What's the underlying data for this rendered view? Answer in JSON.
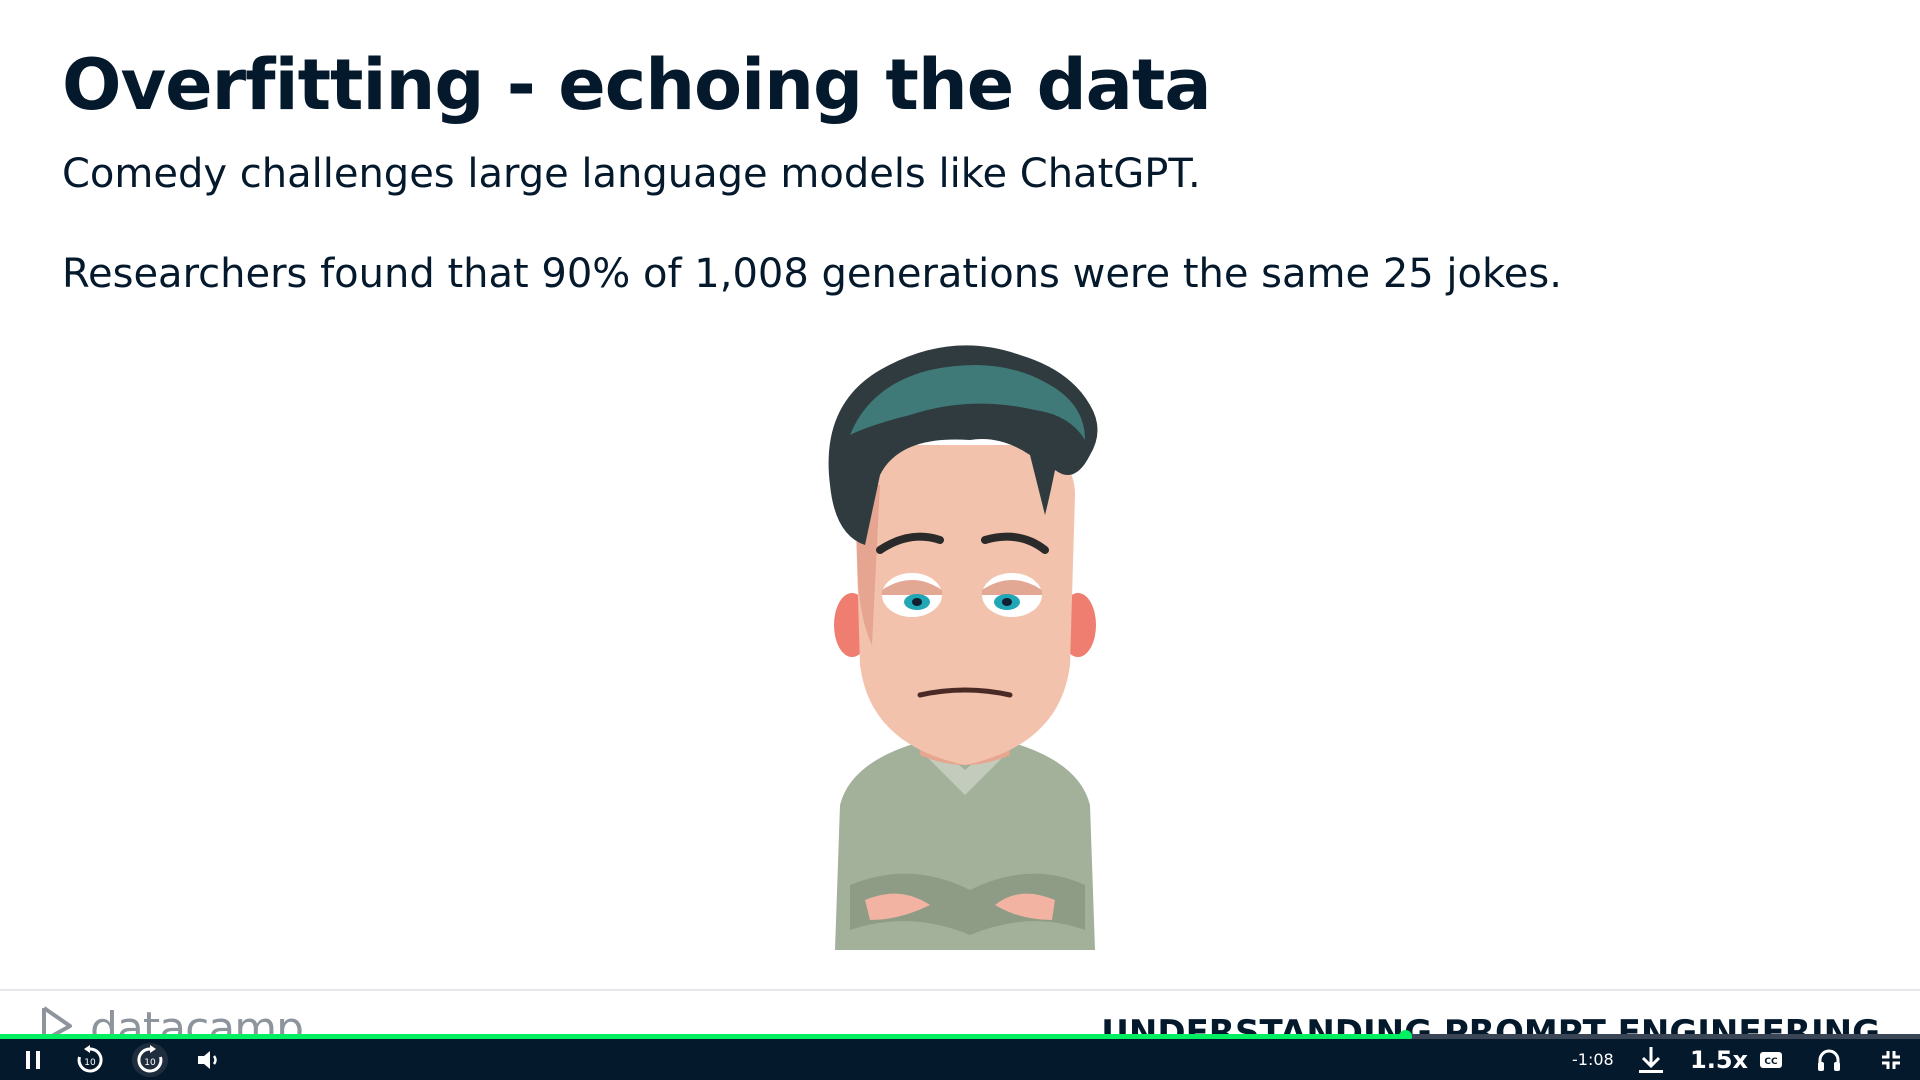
{
  "slide": {
    "title": "Overfitting - echoing the data",
    "line1": "Comedy challenges large language models like ChatGPT.",
    "line2": "Researchers found that 90% of 1,008 generations were the same 25 jokes.",
    "illustration_icon": "bored-cartoon-man-illustration"
  },
  "footer": {
    "logo_text": "datacamp",
    "course_title": "UNDERSTANDING PROMPT ENGINEERING"
  },
  "player": {
    "progress_fraction": 0.732,
    "time_remaining": "-1:08",
    "speed": "1.5x",
    "colors": {
      "accent": "#03ef62",
      "bar_bg": "#05192d",
      "text": "#05192d"
    },
    "icons": [
      "pause-icon",
      "rewind-10-icon",
      "forward-10-icon",
      "volume-icon",
      "download-icon",
      "captions-icon",
      "headphones-icon",
      "exit-fullscreen-icon"
    ]
  }
}
